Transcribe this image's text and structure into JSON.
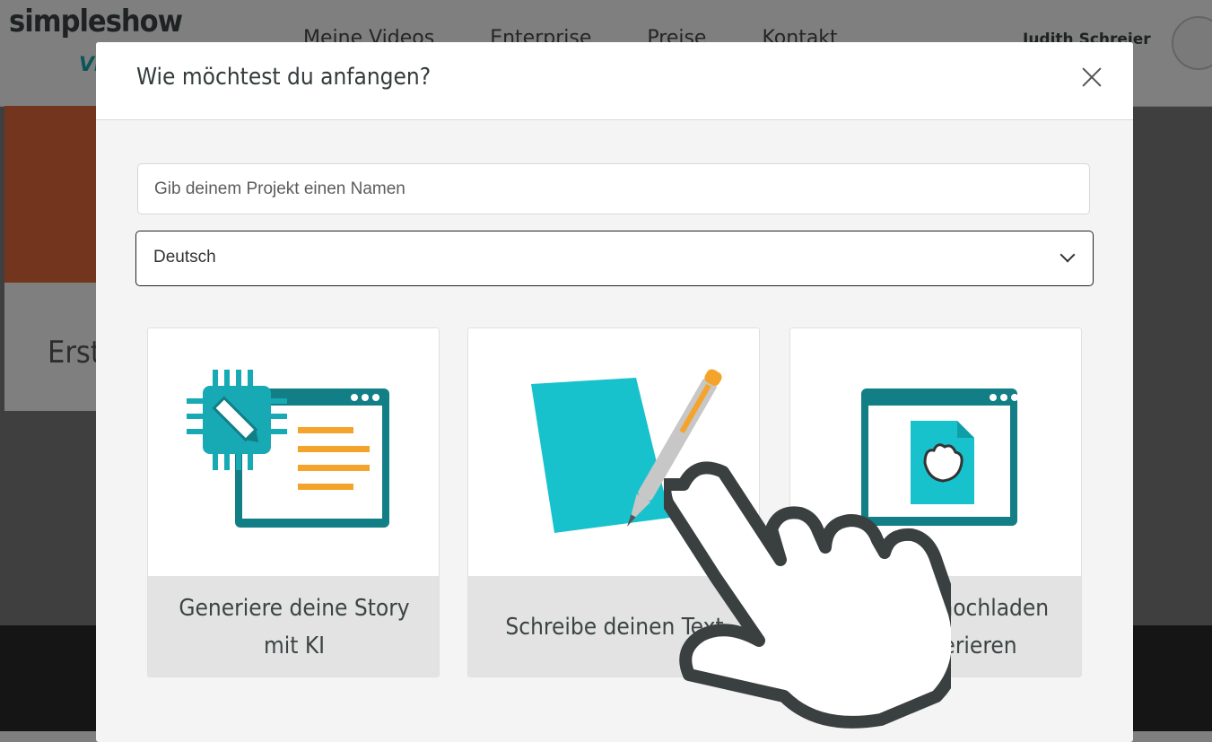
{
  "header": {
    "logo": "simpleshow",
    "logo_sub": "VI",
    "nav": [
      "Meine Videos",
      "Enterprise",
      "Preise",
      "Kontakt"
    ],
    "user_name": "Judith Schreier"
  },
  "background": {
    "card_title": "Erst"
  },
  "modal": {
    "title": "Wie möchtest du anfangen?",
    "name_placeholder": "Gib deinem Projekt einen Namen",
    "language_selected": "Deutsch",
    "options": [
      {
        "label": "Generiere deine Story mit KI",
        "icon": "ai-chip-window-icon"
      },
      {
        "label": "Schreibe deinen Text",
        "icon": "paper-pen-icon"
      },
      {
        "label": "Dokument hochladen und generieren",
        "icon": "upload-document-icon"
      }
    ]
  },
  "colors": {
    "teal": "#17a9b4",
    "teal_dark": "#127e86",
    "orange": "#f4a42a",
    "text": "#3c4444"
  }
}
